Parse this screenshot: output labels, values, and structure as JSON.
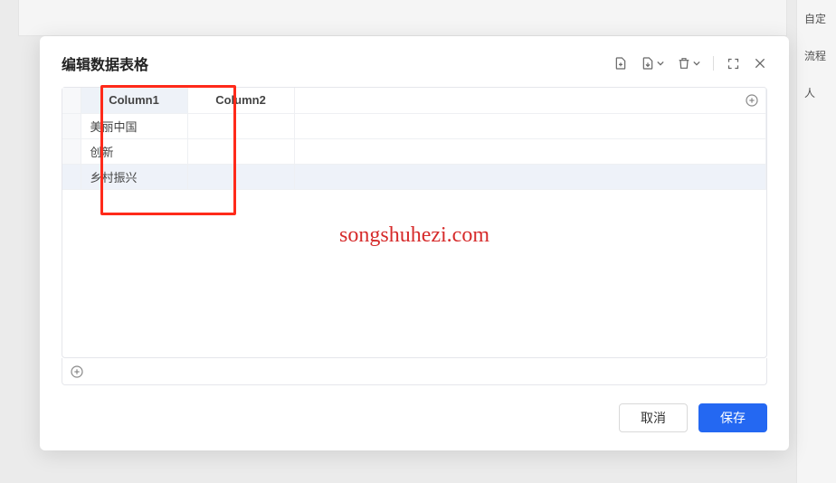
{
  "sidebar_right": {
    "item1": "自定",
    "item2": "流程",
    "item3": "人"
  },
  "modal": {
    "title": "编辑数据表格",
    "footer": {
      "cancel": "取消",
      "save": "保存"
    }
  },
  "table": {
    "headers": [
      "Column1",
      "Column2"
    ],
    "rows": [
      {
        "col1": "美丽中国",
        "col2": ""
      },
      {
        "col1": "创新",
        "col2": ""
      },
      {
        "col1": "乡村振兴",
        "col2": ""
      }
    ]
  },
  "watermark": "songshuhezi.com"
}
